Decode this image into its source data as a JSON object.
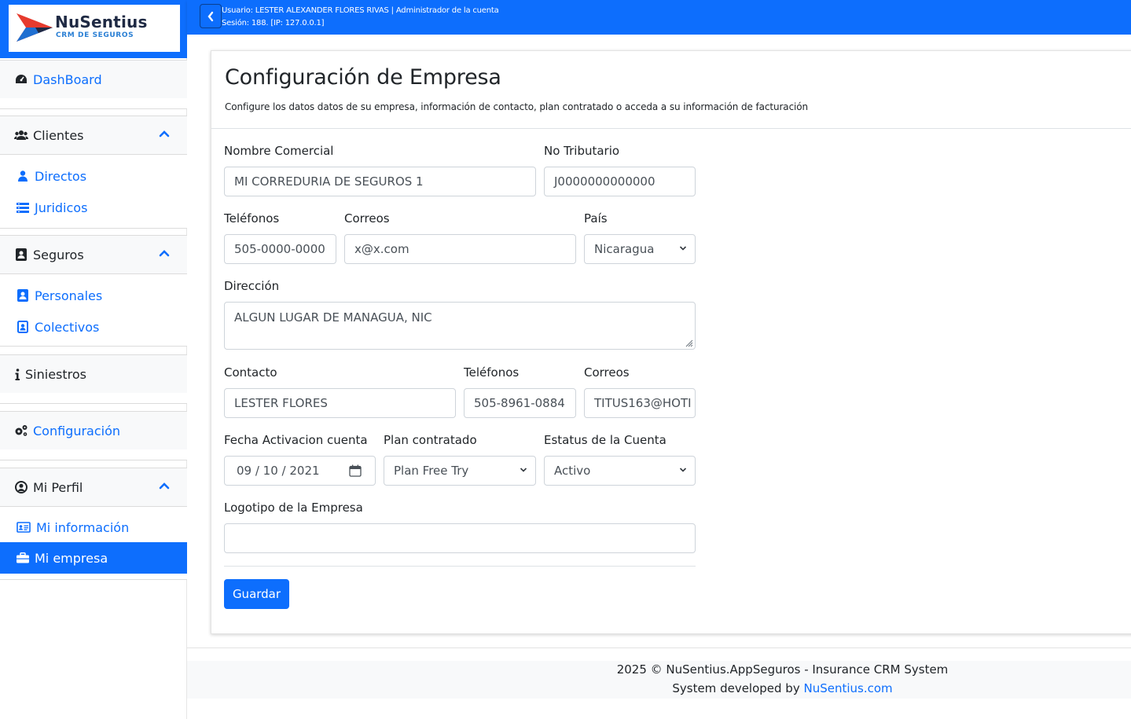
{
  "brand": {
    "name": "NuSentius",
    "tagline": "CRM DE SEGUROS",
    "colors": {
      "primary": "#0d6efd",
      "logo_red": "#e63b2e",
      "logo_blue": "#1f6fd1",
      "logo_dark": "#1f2a44"
    }
  },
  "topbar": {
    "user_line": "Usuario: LESTER ALEXANDER FLORES RIVAS | Administrador de la cuenta",
    "session_line": "Sesión: 188. [IP: 127.0.0.1]",
    "toggle_icon": "chevron-left-icon"
  },
  "sidebar": {
    "dashboard": {
      "label": "DashBoard",
      "icon": "dashboard-icon"
    },
    "clientes": {
      "label": "Clientes",
      "icon": "users-icon",
      "expanded": true,
      "items": [
        {
          "label": "Directos",
          "icon": "user-icon"
        },
        {
          "label": "Juridicos",
          "icon": "list-icon"
        }
      ]
    },
    "seguros": {
      "label": "Seguros",
      "icon": "contact-book-icon",
      "expanded": true,
      "items": [
        {
          "label": "Personales",
          "icon": "portrait-icon"
        },
        {
          "label": "Colectivos",
          "icon": "portrait-box-icon"
        }
      ]
    },
    "siniestros": {
      "label": "Siniestros",
      "icon": "info-icon"
    },
    "configuracion": {
      "label": "Configuración",
      "icon": "gears-icon"
    },
    "mi_perfil": {
      "label": "Mi Perfil",
      "icon": "user-circle-icon",
      "expanded": true,
      "items": [
        {
          "label": "Mi información",
          "icon": "id-card-icon"
        },
        {
          "label": "Mi empresa",
          "icon": "briefcase-icon",
          "active": true
        }
      ]
    }
  },
  "page": {
    "title": "Configuración de Empresa",
    "description": "Configure los datos datos de su empresa, información de contacto, plan contratado o acceda a su información de facturación"
  },
  "form": {
    "nombre_comercial": {
      "label": "Nombre Comercial",
      "value": "MI CORREDURIA DE SEGUROS 1"
    },
    "no_tributario": {
      "label": "No Tributario",
      "value": "J0000000000000"
    },
    "telefonos": {
      "label": "Teléfonos",
      "value": "505-0000-0000"
    },
    "correos": {
      "label": "Correos",
      "value": "x@x.com"
    },
    "pais": {
      "label": "País",
      "value": "Nicaragua"
    },
    "direccion": {
      "label": "Dirección",
      "value": "ALGUN LUGAR DE MANAGUA, NIC"
    },
    "contacto": {
      "label": "Contacto",
      "value": "LESTER FLORES"
    },
    "contacto_telefonos": {
      "label": "Teléfonos",
      "value": "505-8961-0884"
    },
    "contacto_correos": {
      "label": "Correos",
      "value": "TITUS163@HOTI"
    },
    "fecha_activacion": {
      "label": "Fecha Activacion cuenta",
      "value": "09 / 10 / 2021"
    },
    "plan": {
      "label": "Plan contratado",
      "value": "Plan Free Try"
    },
    "estatus": {
      "label": "Estatus de la Cuenta",
      "value": "Activo"
    },
    "logotipo": {
      "label": "Logotipo de la Empresa",
      "value": ""
    },
    "save_label": "Guardar"
  },
  "footer": {
    "copyright": "2025 © NuSentius.AppSeguros - Insurance CRM System",
    "developed_prefix": "System developed by ",
    "developed_link": "NuSentius.com"
  }
}
